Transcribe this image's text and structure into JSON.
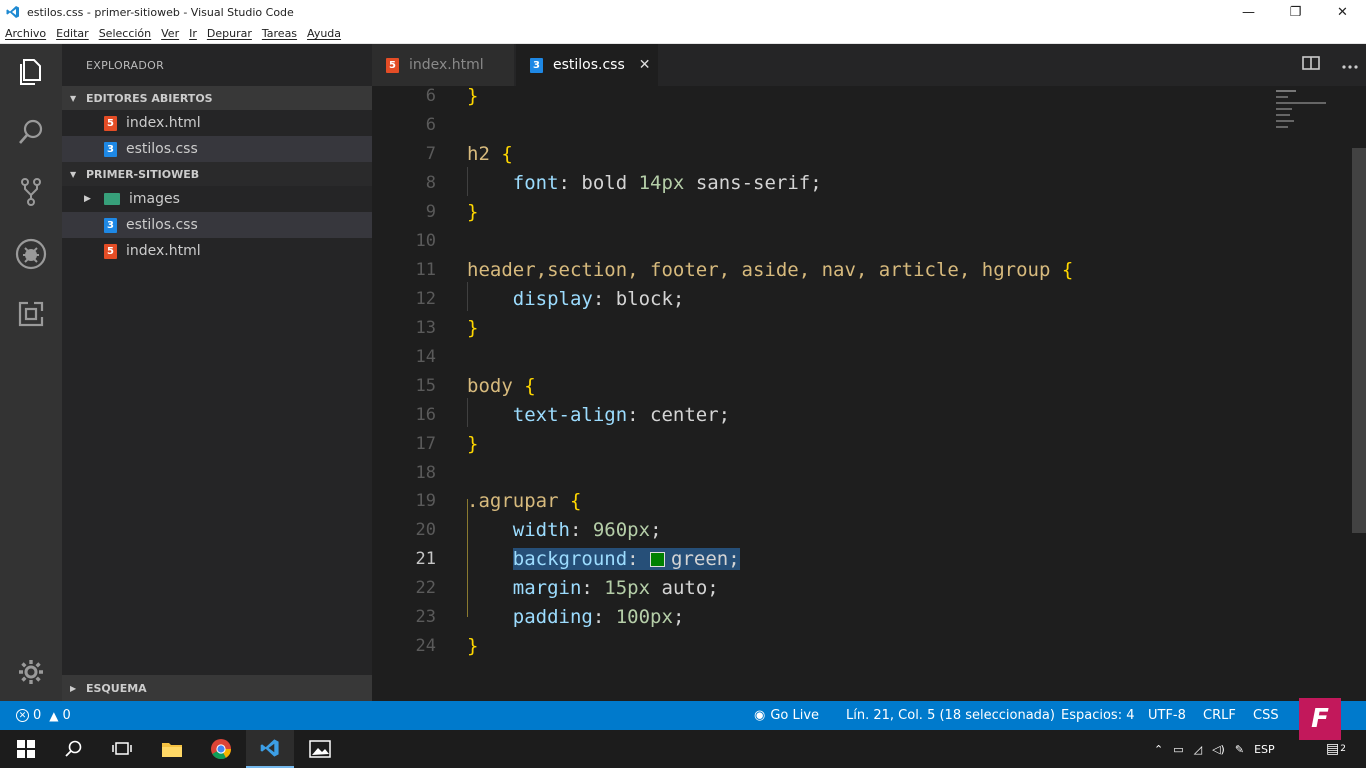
{
  "window": {
    "title": "estilos.css - primer-sitioweb - Visual Studio Code",
    "minimize_glyph": "—",
    "restore_glyph": "❐",
    "close_glyph": "✕"
  },
  "menu": [
    "Archivo",
    "Editar",
    "Selección",
    "Ver",
    "Ir",
    "Depurar",
    "Tareas",
    "Ayuda"
  ],
  "activity": [
    "files-icon",
    "search-icon",
    "source-control-icon",
    "debug-icon",
    "extensions-icon",
    "settings-gear-icon"
  ],
  "sidebar": {
    "title": "EXPLORADOR",
    "open_editors_header": "EDITORES ABIERTOS",
    "open_editors": [
      {
        "label": "index.html",
        "type": "html",
        "icon": "5"
      },
      {
        "label": "estilos.css",
        "type": "css",
        "icon": "3"
      }
    ],
    "project_header": "PRIMER-SITIOWEB",
    "project_items": [
      {
        "label": "images",
        "type": "folder"
      },
      {
        "label": "estilos.css",
        "type": "css",
        "icon": "3"
      },
      {
        "label": "index.html",
        "type": "html",
        "icon": "5"
      }
    ],
    "outline_header": "ESQUEMA"
  },
  "tabs": [
    {
      "label": "index.html",
      "type": "html",
      "icon": "5",
      "active": false
    },
    {
      "label": "estilos.css",
      "type": "css",
      "icon": "3",
      "active": true,
      "close": "✕"
    }
  ],
  "editor": {
    "current_line": 21,
    "lines": [
      {
        "n": "6",
        "text": ""
      },
      {
        "n": "7",
        "text": "h2 {"
      },
      {
        "n": "8",
        "text": "    font: bold 14px sans-serif;"
      },
      {
        "n": "9",
        "text": "}"
      },
      {
        "n": "10",
        "text": ""
      },
      {
        "n": "11",
        "text": "header,section, footer, aside, nav, article, hgroup {"
      },
      {
        "n": "12",
        "text": "    display: block;"
      },
      {
        "n": "13",
        "text": "}"
      },
      {
        "n": "14",
        "text": ""
      },
      {
        "n": "15",
        "text": "body {"
      },
      {
        "n": "16",
        "text": "    text-align: center;"
      },
      {
        "n": "17",
        "text": "}"
      },
      {
        "n": "18",
        "text": ""
      },
      {
        "n": "19",
        "text": ".agrupar {"
      },
      {
        "n": "20",
        "text": "    width: 960px;"
      },
      {
        "n": "21",
        "text": "    background: green;"
      },
      {
        "n": "22",
        "text": "    margin: 15px auto;"
      },
      {
        "n": "23",
        "text": "    padding: 100px;"
      },
      {
        "n": "24",
        "text": "}"
      }
    ]
  },
  "statusbar": {
    "errors": "0",
    "warnings": "0",
    "go_live": "Go Live",
    "position": "Lín. 21, Col. 5 (18 seleccionada)",
    "spaces": "Espacios: 4",
    "encoding": "UTF-8",
    "eol": "CRLF",
    "language": "CSS"
  },
  "taskbar": {
    "apps": [
      "windows-start-icon",
      "search-icon",
      "task-view-icon",
      "file-explorer-icon",
      "chrome-icon",
      "vscode-icon",
      "photos-icon"
    ],
    "lang": "ESP",
    "notifications": "2"
  },
  "badge": "F",
  "colors": {
    "accent": "#007acc",
    "editor_bg": "#1e1e1e",
    "sidebar_bg": "#252526",
    "activity_bg": "#333333",
    "selector": "#d7ba7d",
    "property": "#9cdcfe",
    "number": "#b5cea8",
    "brace": "#ffd700"
  }
}
